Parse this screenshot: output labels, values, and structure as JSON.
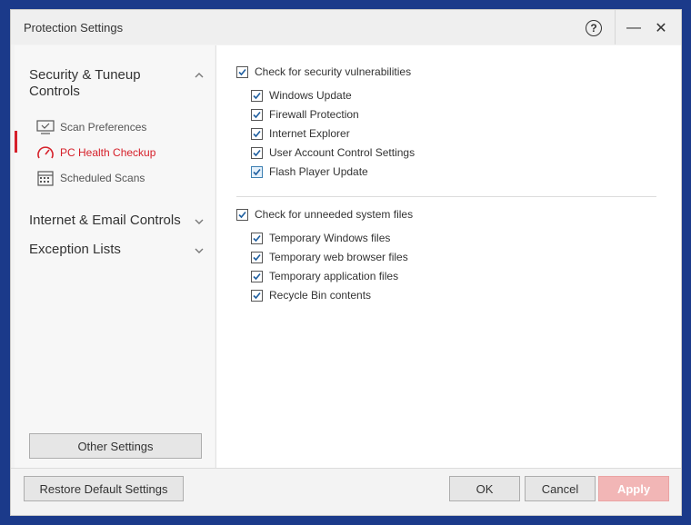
{
  "window": {
    "title": "Protection Settings",
    "help_label": "?",
    "minimize_label": "—",
    "close_label": "✕"
  },
  "sidebar": {
    "sections": [
      {
        "title_line1": "Security & Tuneup",
        "title_line2": "Controls",
        "expanded": true
      },
      {
        "title": "Internet & Email Controls",
        "expanded": false
      },
      {
        "title": "Exception Lists",
        "expanded": false
      }
    ],
    "items": [
      {
        "label": "Scan Preferences",
        "icon": "monitor-check-icon",
        "active": false
      },
      {
        "label": "PC Health Checkup",
        "icon": "gauge-icon",
        "active": true
      },
      {
        "label": "Scheduled Scans",
        "icon": "calendar-icon",
        "active": false
      }
    ],
    "other_settings_label": "Other Settings",
    "accent_color": "#d6202a"
  },
  "main": {
    "group1": {
      "label": "Check for security vulnerabilities",
      "checked": true,
      "items": [
        {
          "label": "Windows Update",
          "checked": true
        },
        {
          "label": "Firewall Protection",
          "checked": true
        },
        {
          "label": "Internet Explorer",
          "checked": true
        },
        {
          "label": "User Account Control Settings",
          "checked": true
        },
        {
          "label": "Flash Player Update",
          "checked": true
        }
      ]
    },
    "group2": {
      "label": "Check for unneeded system files",
      "checked": true,
      "items": [
        {
          "label": "Temporary Windows files",
          "checked": true
        },
        {
          "label": "Temporary web browser files",
          "checked": true
        },
        {
          "label": "Temporary application files",
          "checked": true
        },
        {
          "label": "Recycle Bin contents",
          "checked": true
        }
      ]
    }
  },
  "footer": {
    "restore_label": "Restore Default Settings",
    "ok_label": "OK",
    "cancel_label": "Cancel",
    "apply_label": "Apply"
  }
}
